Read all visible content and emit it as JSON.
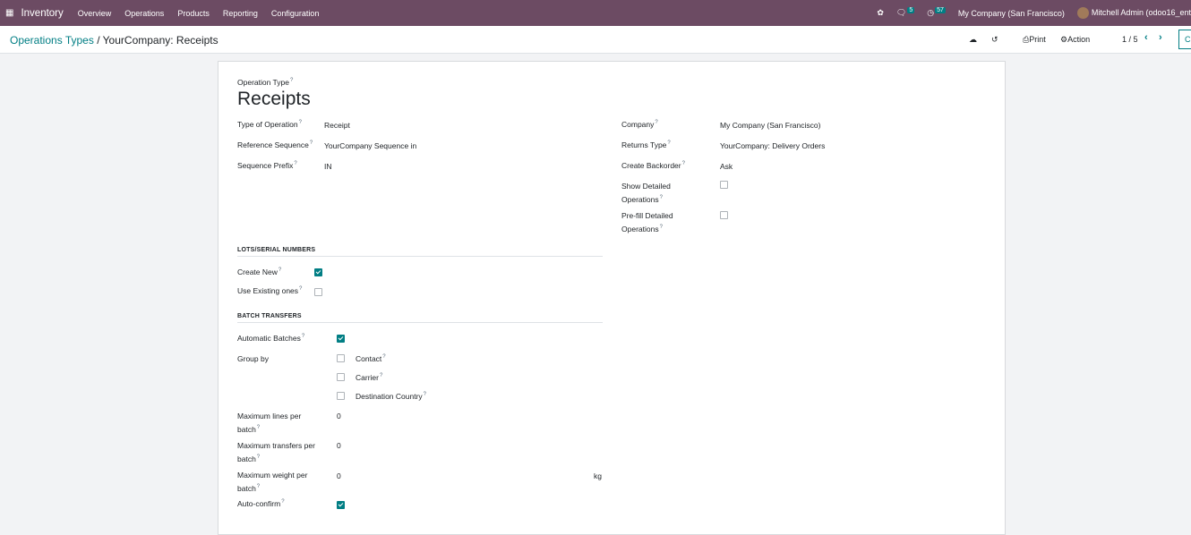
{
  "navbar": {
    "app": "Inventory",
    "menus": [
      "Overview",
      "Operations",
      "Products",
      "Reporting",
      "Configuration"
    ],
    "messages_count": "5",
    "activities_count": "57",
    "company": "My Company (San Francisco)",
    "user": "Mitchell Admin (odoo16_ent"
  },
  "control_panel": {
    "breadcrumb_parent": "Operations Types",
    "breadcrumb_sep": "/",
    "breadcrumb_current": "YourCompany: Receipts",
    "print": "Print",
    "action": "Action",
    "pager": "1 / 5",
    "new": "Cr"
  },
  "form": {
    "title_label": "Operation Type",
    "title": "Receipts",
    "left": [
      {
        "label": "Type of Operation",
        "value": "Receipt"
      },
      {
        "label": "Reference Sequence",
        "value": "YourCompany Sequence in"
      },
      {
        "label": "Sequence Prefix",
        "value": "IN"
      }
    ],
    "right": [
      {
        "label": "Company",
        "value": "My Company (San Francisco)"
      },
      {
        "label": "Returns Type",
        "value": "YourCompany: Delivery Orders"
      },
      {
        "label": "Create Backorder",
        "value": "Ask"
      },
      {
        "label": "Show Detailed Operations",
        "checked": false
      },
      {
        "label": "Pre-fill Detailed Operations",
        "checked": false
      }
    ],
    "lots_header": "LOTS/SERIAL NUMBERS",
    "create_new": {
      "label": "Create New",
      "checked": true
    },
    "use_existing": {
      "label": "Use Existing ones",
      "checked": false
    },
    "batch_header": "BATCH TRANSFERS",
    "automatic_batches": {
      "label": "Automatic Batches",
      "checked": true
    },
    "group_by": {
      "label": "Group by",
      "options": [
        {
          "label": "Contact",
          "checked": false
        },
        {
          "label": "Carrier",
          "checked": false
        },
        {
          "label": "Destination Country",
          "checked": false
        }
      ]
    },
    "max_lines": {
      "label1": "Maximum lines per",
      "label2": "batch",
      "value": "0"
    },
    "max_transfers": {
      "label1": "Maximum transfers per",
      "label2": "batch",
      "value": "0"
    },
    "max_weight": {
      "label1": "Maximum weight per",
      "label2": "batch",
      "value": "0",
      "unit": "kg"
    },
    "auto_confirm": {
      "label": "Auto-confirm",
      "checked": true
    }
  }
}
